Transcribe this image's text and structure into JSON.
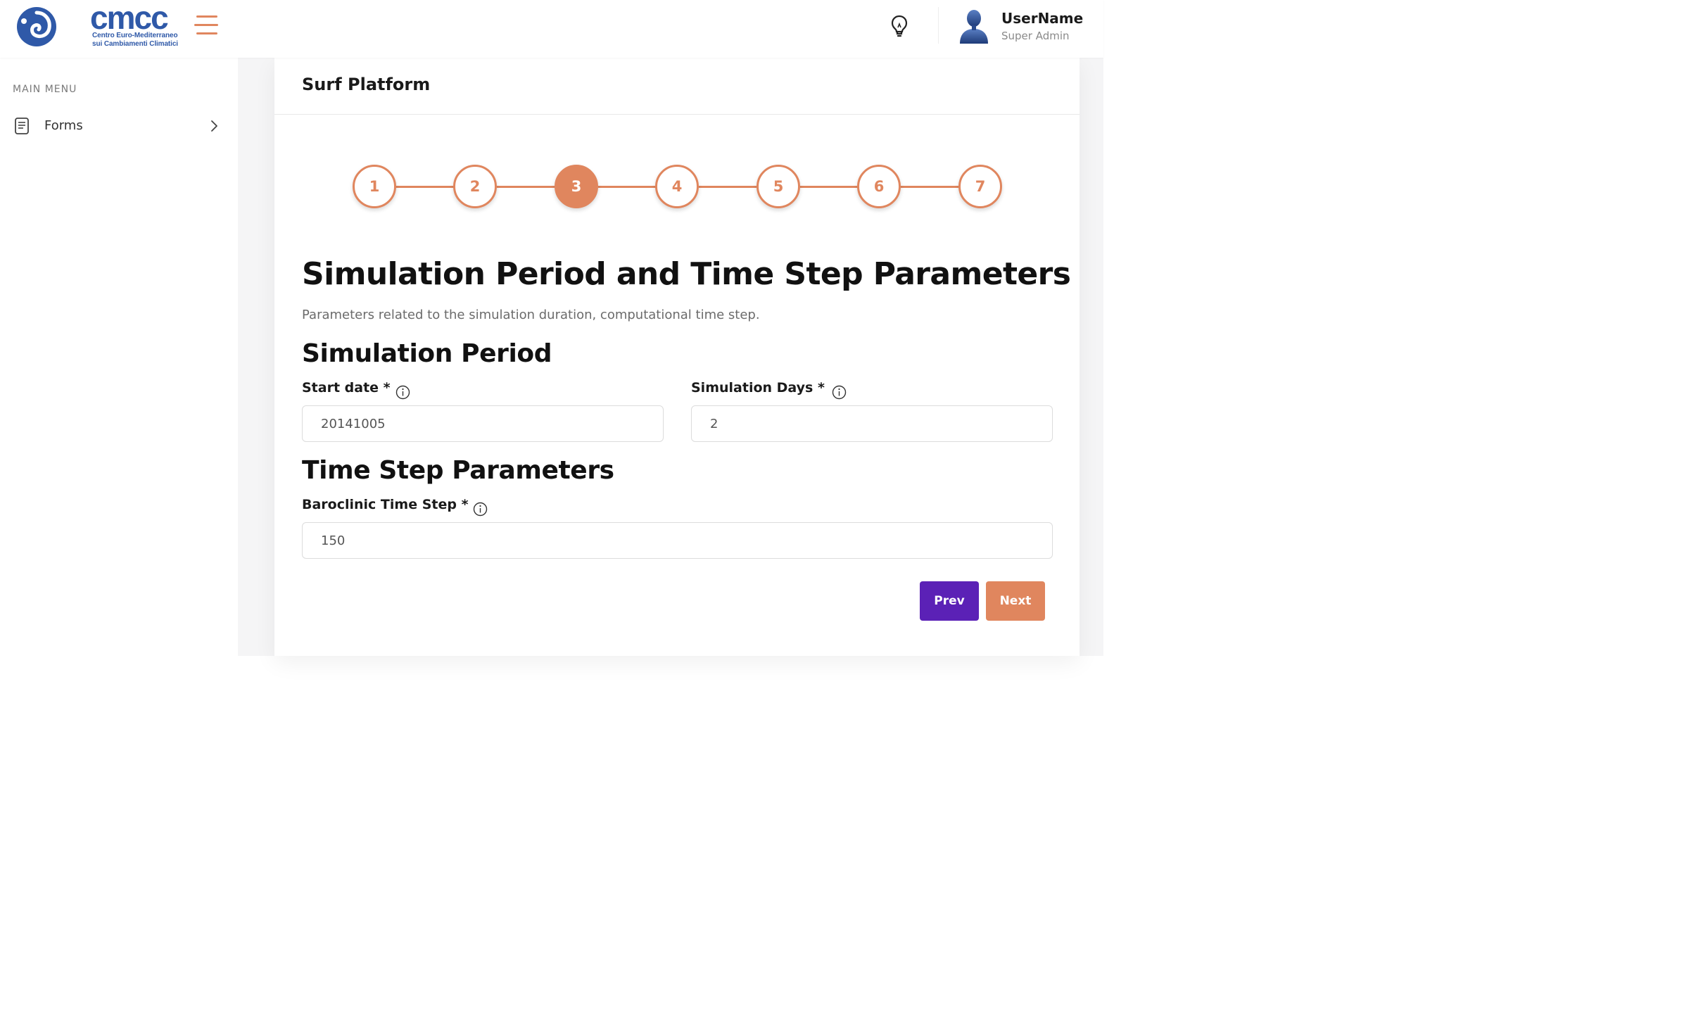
{
  "header": {
    "logo_text": "cmcc",
    "logo_subtitle_line1": "Centro Euro-Mediterraneo",
    "logo_subtitle_line2": "sui Cambiamenti Climatici",
    "user_name": "UserName",
    "user_role": "Super Admin"
  },
  "sidebar": {
    "heading": "MAIN MENU",
    "items": [
      {
        "label": "Forms",
        "icon": "document-icon"
      }
    ]
  },
  "card": {
    "title": "Surf Platform"
  },
  "stepper": {
    "steps": [
      "1",
      "2",
      "3",
      "4",
      "5",
      "6",
      "7"
    ],
    "active_step": "3"
  },
  "form": {
    "title": "Simulation Period and Time Step Parameters",
    "description": "Parameters related to the simulation duration, computational time step.",
    "sections": [
      {
        "title": "Simulation Period",
        "fields": [
          {
            "label": "Start date *",
            "value": "20141005"
          },
          {
            "label": "Simulation Days *",
            "value": "2"
          }
        ]
      },
      {
        "title": "Time Step Parameters",
        "fields": [
          {
            "label": "Baroclinic Time Step *",
            "value": "150"
          }
        ]
      }
    ]
  },
  "buttons": {
    "prev_label": "Prev",
    "next_label": "Next"
  },
  "colors": {
    "brand_blue": "#2f59a8",
    "accent_orange": "#e0865e",
    "prev_purple": "#5b21b6"
  }
}
